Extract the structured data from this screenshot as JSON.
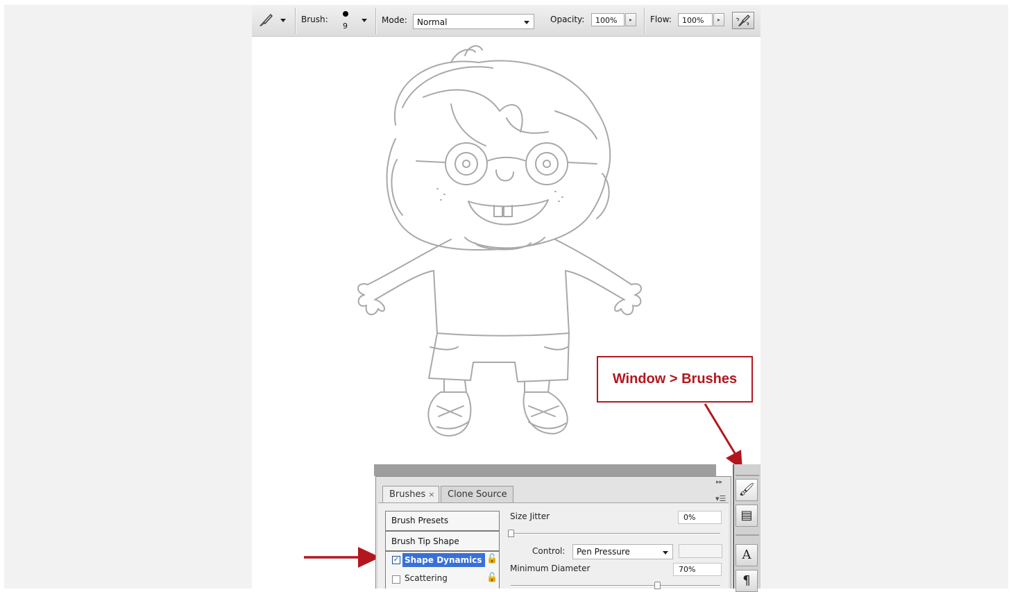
{
  "options_bar": {
    "tool_icon": "brush-icon",
    "brush_label": "Brush:",
    "brush_size": "9",
    "mode_label": "Mode:",
    "mode_value": "Normal",
    "opacity_label": "Opacity:",
    "opacity_value": "100%",
    "flow_label": "Flow:",
    "flow_value": "100%",
    "airbrush_icon": "airbrush-icon"
  },
  "callout": {
    "text": "Window > Brushes"
  },
  "brushes_panel": {
    "tabs": [
      {
        "label": "Brushes",
        "close": "×",
        "active": true
      },
      {
        "label": "Clone Source",
        "active": false
      }
    ],
    "collapse_glyph": "▸▸",
    "menu_glyph": "▾☰",
    "list": [
      {
        "label": "Brush Presets"
      },
      {
        "label": "Brush Tip Shape"
      },
      {
        "label": "Shape Dynamics",
        "checked": true,
        "selected": true
      },
      {
        "label": "Scattering",
        "checked": false
      }
    ],
    "check_glyph": "✓",
    "lock_glyph": "🔓",
    "options": {
      "size_jitter_label": "Size Jitter",
      "size_jitter_value": "0%",
      "control_label": "Control:",
      "control_value": "Pen Pressure",
      "minimum_diameter_label": "Minimum Diameter",
      "minimum_diameter_value": "70%"
    }
  },
  "dock": {
    "buttons": [
      {
        "icon": "brushes-panel-icon",
        "glyph": "🖌"
      },
      {
        "icon": "clone-source-icon",
        "glyph": "▤"
      },
      {
        "icon": "character-panel-icon",
        "glyph": "A"
      },
      {
        "icon": "paragraph-panel-icon",
        "glyph": "¶"
      }
    ]
  },
  "colors": {
    "accent_red": "#b4161e",
    "selection_blue": "#3870d8"
  }
}
